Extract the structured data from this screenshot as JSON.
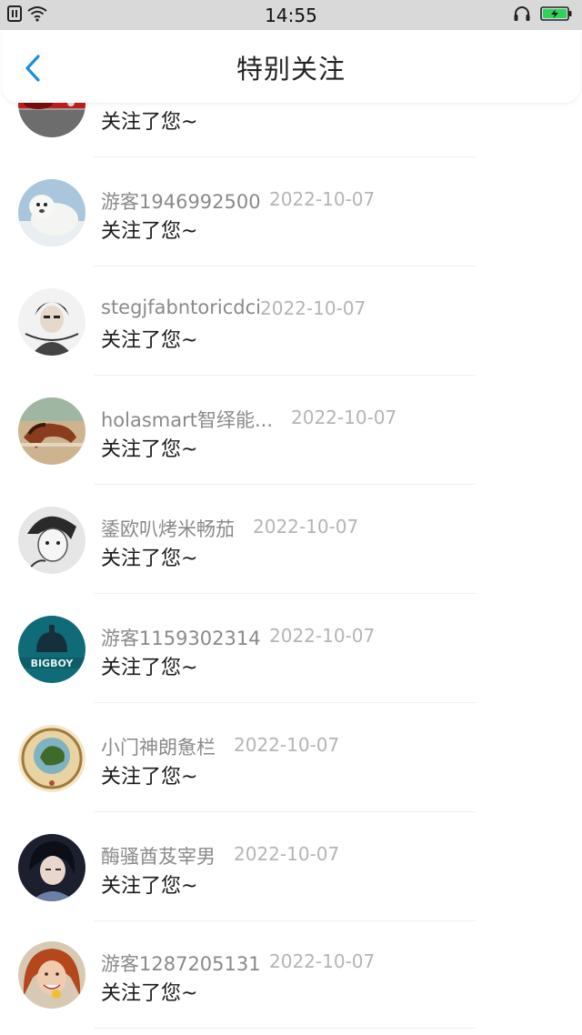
{
  "status_bar": {
    "time": "14:55",
    "icons": [
      "sim-icon",
      "wifi-icon",
      "headset-icon",
      "battery-charging-icon"
    ]
  },
  "header": {
    "title": "特别关注",
    "back_icon": "chevron-left-icon",
    "accent_color": "#1a8fe0"
  },
  "follows": [
    {
      "name": "",
      "date": "",
      "message": "关注了您~"
    },
    {
      "name": "游客1946992500",
      "date": "2022-10-07",
      "message": "关注了您~"
    },
    {
      "name": "stegjfabntoricdci",
      "date": "2022-10-07",
      "message": "关注了您~"
    },
    {
      "name": "holasmart智绎能...",
      "date": "2022-10-07",
      "message": "关注了您~"
    },
    {
      "name": "鋈欧叭烤米畅茄",
      "date": "2022-10-07",
      "message": "关注了您~"
    },
    {
      "name": "游客1159302314",
      "date": "2022-10-07",
      "message": "关注了您~"
    },
    {
      "name": "小门神朗惫栏",
      "date": "2022-10-07",
      "message": "关注了您~"
    },
    {
      "name": "酶骚酋芨宰男",
      "date": "2022-10-07",
      "message": "关注了您~"
    },
    {
      "name": "游客1287205131",
      "date": "2022-10-07",
      "message": "关注了您~"
    }
  ],
  "avatar_text": {
    "bigboy": "BIGBOY"
  }
}
